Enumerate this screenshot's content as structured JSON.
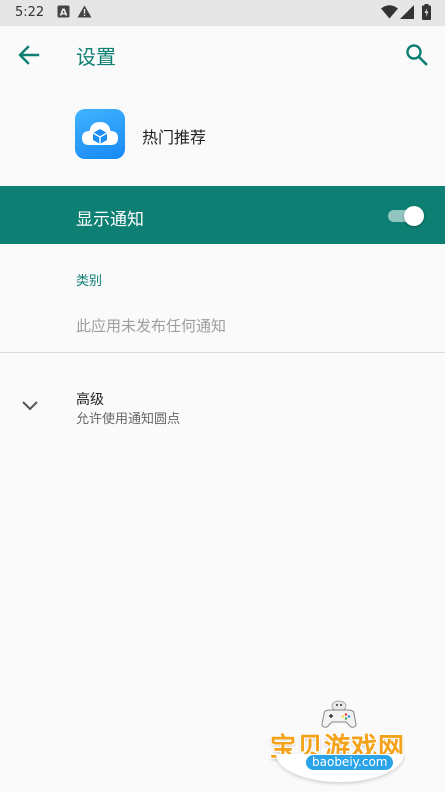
{
  "status_bar": {
    "time": "5:22",
    "icons": [
      "a-notification-icon",
      "warning-icon",
      "wifi-icon",
      "signal-icon",
      "battery-icon"
    ]
  },
  "header": {
    "title": "设置",
    "back_icon": "arrow-back-icon",
    "search_icon": "search-icon"
  },
  "app": {
    "name": "热门推荐",
    "icon": "cloud-box-app-icon"
  },
  "notifications": {
    "label": "显示通知",
    "enabled": true
  },
  "category": {
    "header": "类别",
    "empty_text": "此应用未发布任何通知"
  },
  "advanced": {
    "title": "高级",
    "subtitle": "允许使用通知圆点"
  },
  "watermark": {
    "title": "宝贝游戏网",
    "url": "baobeiy.com"
  },
  "colors": {
    "accent": "#0d7f73",
    "background": "#fafafa",
    "status_bar": "#e6e6e6"
  }
}
